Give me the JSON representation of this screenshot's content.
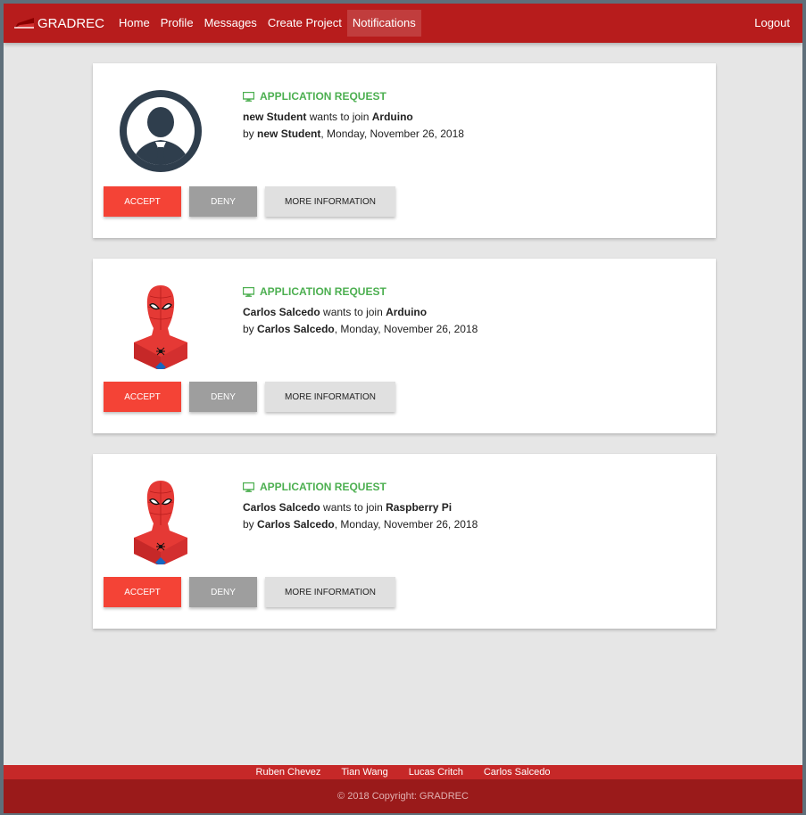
{
  "brand": {
    "name": "GRADREC",
    "logo": "brand-logo"
  },
  "nav": {
    "items": [
      {
        "label": "Home"
      },
      {
        "label": "Profile"
      },
      {
        "label": "Messages"
      },
      {
        "label": "Create Project"
      },
      {
        "label": "Notifications",
        "active": true
      }
    ],
    "logout": "Logout"
  },
  "notifications": [
    {
      "type": "APPLICATION REQUEST",
      "type_icon": "monitor-icon",
      "avatar": "default-user-avatar",
      "requester": "new Student",
      "wants_text": "wants to join",
      "project": "Arduino",
      "by_text": "by",
      "by_name": "new Student",
      "date": "Monday, November 26, 2018"
    },
    {
      "type": "APPLICATION REQUEST",
      "type_icon": "monitor-icon",
      "avatar": "spiderman-avatar",
      "requester": "Carlos Salcedo",
      "wants_text": "wants to join",
      "project": "Arduino",
      "by_text": "by",
      "by_name": "Carlos Salcedo",
      "date": "Monday, November 26, 2018"
    },
    {
      "type": "APPLICATION REQUEST",
      "type_icon": "monitor-icon",
      "avatar": "spiderman-avatar",
      "requester": "Carlos Salcedo",
      "wants_text": "wants to join",
      "project": "Raspberry Pi",
      "by_text": "by",
      "by_name": "Carlos Salcedo",
      "date": "Monday, November 26, 2018"
    }
  ],
  "buttons": {
    "accept": "ACCEPT",
    "deny": "DENY",
    "more": "MORE INFORMATION"
  },
  "footer": {
    "authors": [
      "Ruben Chevez",
      "Tian Wang",
      "Lucas Critch",
      "Carlos Salcedo"
    ],
    "copyright": "© 2018 Copyright: GRADREC"
  },
  "colors": {
    "primary": "#b71c1c",
    "accept": "#f44336",
    "deny": "#9e9e9e",
    "success": "#4caf50"
  }
}
